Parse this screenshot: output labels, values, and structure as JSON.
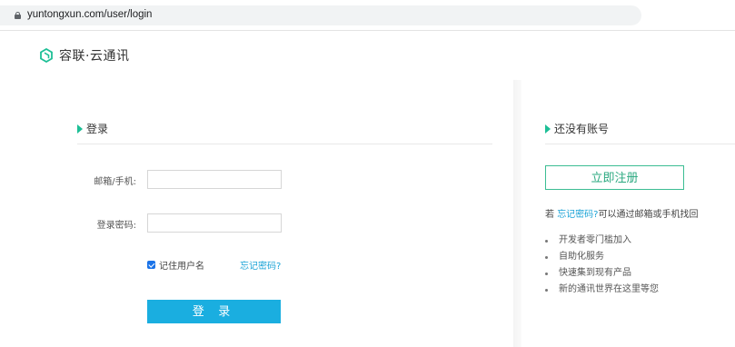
{
  "browser": {
    "url": "yuntongxun.com/user/login"
  },
  "logo": {
    "text": "容联·云通讯",
    "brand_color": "#1dbf96"
  },
  "login": {
    "title": "登录",
    "email_label": "邮箱/手机:",
    "email_value": "",
    "password_label": "登录密码:",
    "password_value": "",
    "remember_label": "记住用户名",
    "remember_checked": true,
    "forgot_link": "忘记密码?",
    "submit_label": "登 录"
  },
  "register": {
    "title": "还没有账号",
    "button_label": "立即注册",
    "forgot_prefix": "若",
    "forgot_link": "忘记密码?",
    "forgot_suffix": "可以通过邮箱或手机找回",
    "benefits": [
      "开发者零门槛加入",
      "自助化服务",
      "快速集到现有产品",
      "新的通讯世界在这里等您"
    ]
  },
  "colors": {
    "accent": "#1dbf96",
    "primary_button": "#1aaee0",
    "link": "#1aa3d6"
  }
}
